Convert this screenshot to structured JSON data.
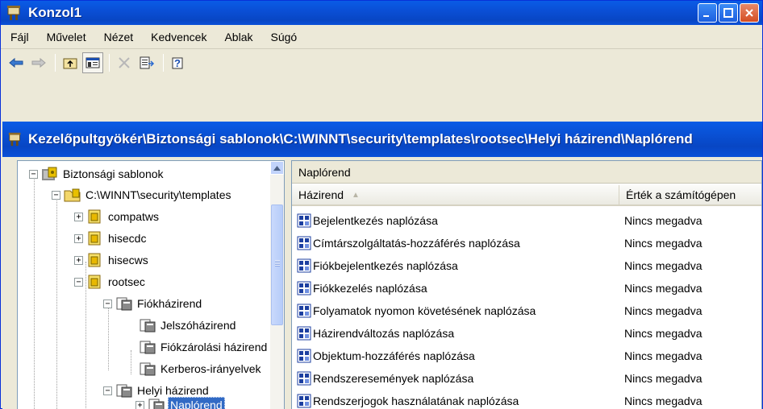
{
  "window": {
    "title": "Konzol1"
  },
  "menu": [
    "Fájl",
    "Művelet",
    "Nézet",
    "Kedvencek",
    "Ablak",
    "Súgó"
  ],
  "child_window": {
    "path": "Kezelőpultgyökér\\Biztonsági sablonok\\C:\\WINNT\\security\\templates\\rootsec\\Helyi házirend\\Naplórend"
  },
  "tree": {
    "items": [
      {
        "label": "Biztonsági sablonok",
        "expander": "−"
      },
      {
        "label": "C:\\WINNT\\security\\templates",
        "expander": "−"
      },
      {
        "label": "compatws",
        "expander": "+"
      },
      {
        "label": "hisecdc",
        "expander": "+"
      },
      {
        "label": "hisecws",
        "expander": "+"
      },
      {
        "label": "rootsec",
        "expander": "−"
      },
      {
        "label": "Fiókházirend",
        "expander": "−"
      },
      {
        "label": "Jelszóházirend",
        "expander": ""
      },
      {
        "label": "Fiókzárolási házirend",
        "expander": ""
      },
      {
        "label": "Kerberos-irányelvek",
        "expander": ""
      },
      {
        "label": "Helyi házirend",
        "expander": "−"
      },
      {
        "label": "Naplórend",
        "expander": "+"
      }
    ]
  },
  "details": {
    "caption": "Naplórend",
    "columns": [
      "Házirend",
      "Érték a számítógépen"
    ],
    "rows": [
      {
        "name": "Bejelentkezés naplózása",
        "value": "Nincs megadva"
      },
      {
        "name": "Címtárszolgáltatás-hozzáférés naplózása",
        "value": "Nincs megadva"
      },
      {
        "name": "Fiókbejelentkezés naplózása",
        "value": "Nincs megadva"
      },
      {
        "name": "Fiókkezelés naplózása",
        "value": "Nincs megadva"
      },
      {
        "name": "Folyamatok nyomon követésének naplózása",
        "value": "Nincs megadva"
      },
      {
        "name": "Házirendváltozás naplózása",
        "value": "Nincs megadva"
      },
      {
        "name": "Objektum-hozzáférés naplózása",
        "value": "Nincs megadva"
      },
      {
        "name": "Rendszeresemények naplózása",
        "value": "Nincs megadva"
      },
      {
        "name": "Rendszerjogok használatának naplózása",
        "value": "Nincs megadva"
      }
    ]
  },
  "colors": {
    "titlebar": "#0a5ce6",
    "selection": "#316ac5",
    "face": "#ece9d8"
  }
}
